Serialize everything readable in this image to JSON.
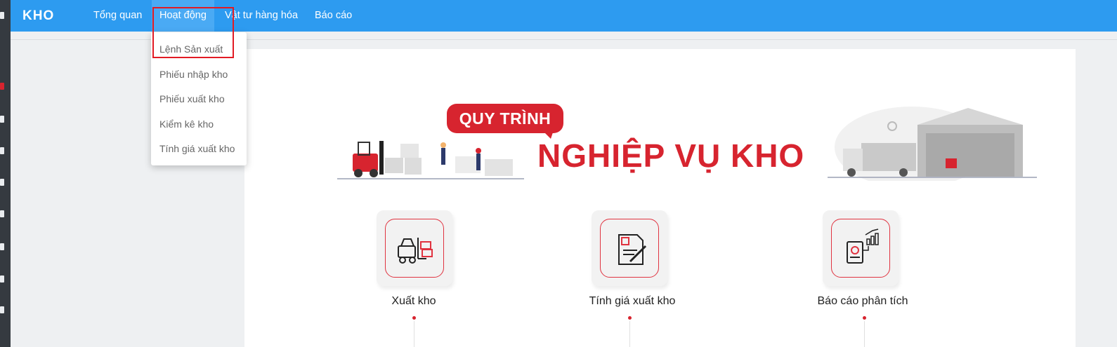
{
  "app": {
    "logo": "KHO"
  },
  "nav": {
    "items": [
      {
        "label": "Tổng quan"
      },
      {
        "label": "Hoạt động"
      },
      {
        "label": "Vật tư hàng hóa"
      },
      {
        "label": "Báo cáo"
      }
    ]
  },
  "dropdown": {
    "items": [
      {
        "label": "Lệnh Sản xuất"
      },
      {
        "label": "Phiếu nhập kho"
      },
      {
        "label": "Phiếu xuất kho"
      },
      {
        "label": "Kiểm kê kho"
      },
      {
        "label": "Tính giá xuất kho"
      }
    ]
  },
  "banner": {
    "tag": "QUY TRÌNH",
    "title": "NGHIỆP VỤ KHO"
  },
  "cards": [
    {
      "label": "Xuất kho",
      "icon": "forklift-icon"
    },
    {
      "label": "Tính giá xuất kho",
      "icon": "document-pen-icon"
    },
    {
      "label": "Báo cáo phân tích",
      "icon": "report-chart-icon"
    }
  ],
  "colors": {
    "topbar": "#2d9bf0",
    "accent": "#d7242f",
    "sidebar": "#353a40"
  }
}
